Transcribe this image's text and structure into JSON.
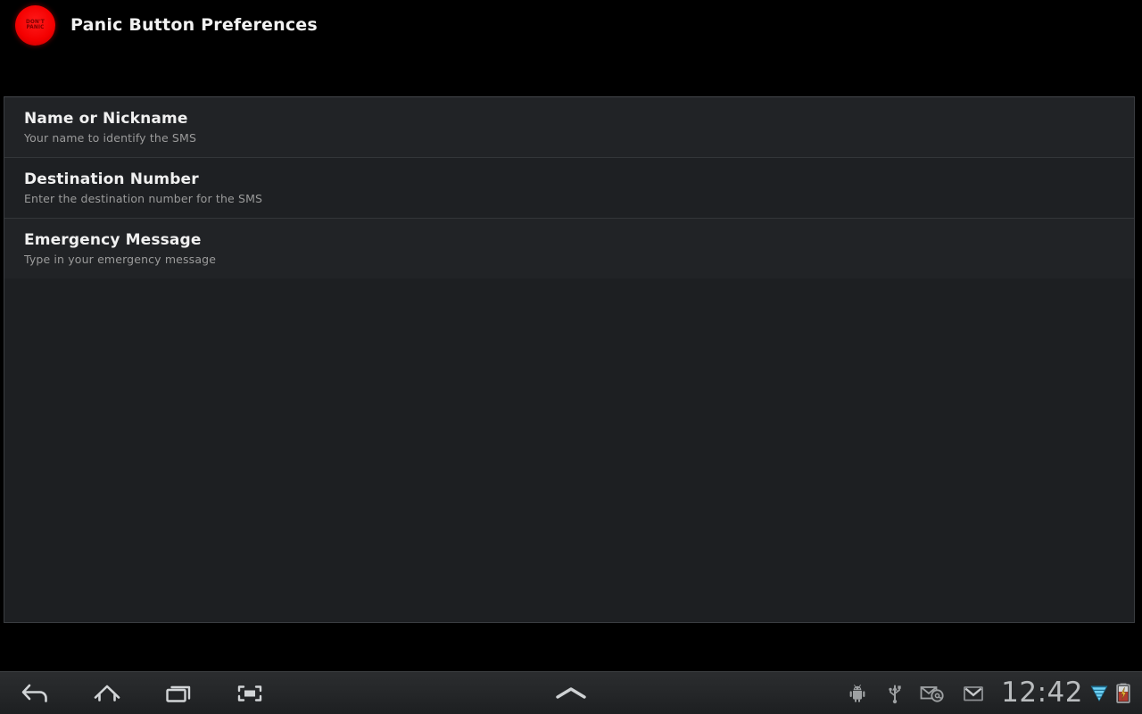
{
  "action_bar": {
    "title": "Panic Button Preferences",
    "app_icon": {
      "name": "panic-button-app-icon",
      "label": "DON'T PANIC",
      "color": "#f40000"
    }
  },
  "preferences": {
    "items": [
      {
        "title": "Name or Nickname",
        "summary": "Your name to identify the SMS"
      },
      {
        "title": "Destination Number",
        "summary": "Enter the destination number for the SMS"
      },
      {
        "title": "Emergency Message",
        "summary": "Type in your emergency message"
      }
    ]
  },
  "system_bar": {
    "nav_buttons": [
      {
        "icon": "back-icon",
        "label": "Back"
      },
      {
        "icon": "home-icon",
        "label": "Home"
      },
      {
        "icon": "recents-icon",
        "label": "Recent apps"
      },
      {
        "icon": "screenshot-icon",
        "label": "Screenshot"
      }
    ],
    "menu_chevron": {
      "icon": "chevron-up-icon",
      "label": "Show menu"
    },
    "status_icons": [
      {
        "icon": "android-robot-icon",
        "label": "Android system"
      },
      {
        "icon": "usb-icon",
        "label": "USB connected"
      },
      {
        "icon": "email-at-icon",
        "label": "Email"
      },
      {
        "icon": "gmail-icon",
        "label": "Gmail"
      }
    ],
    "clock": "12:42",
    "wifi": {
      "icon": "wifi-signal-icon",
      "color": "#33b5e5",
      "bars": 4
    },
    "battery": {
      "icon": "battery-charging-icon",
      "color": "#c0392b",
      "charging": true
    }
  },
  "colors": {
    "background": "#000000",
    "panel_background": "#1d1f22",
    "row_divider": "#333639",
    "title_text": "#f0f0f0",
    "summary_text": "#9b9b9b",
    "accent_red": "#f40000",
    "wifi_blue": "#33b5e5"
  }
}
